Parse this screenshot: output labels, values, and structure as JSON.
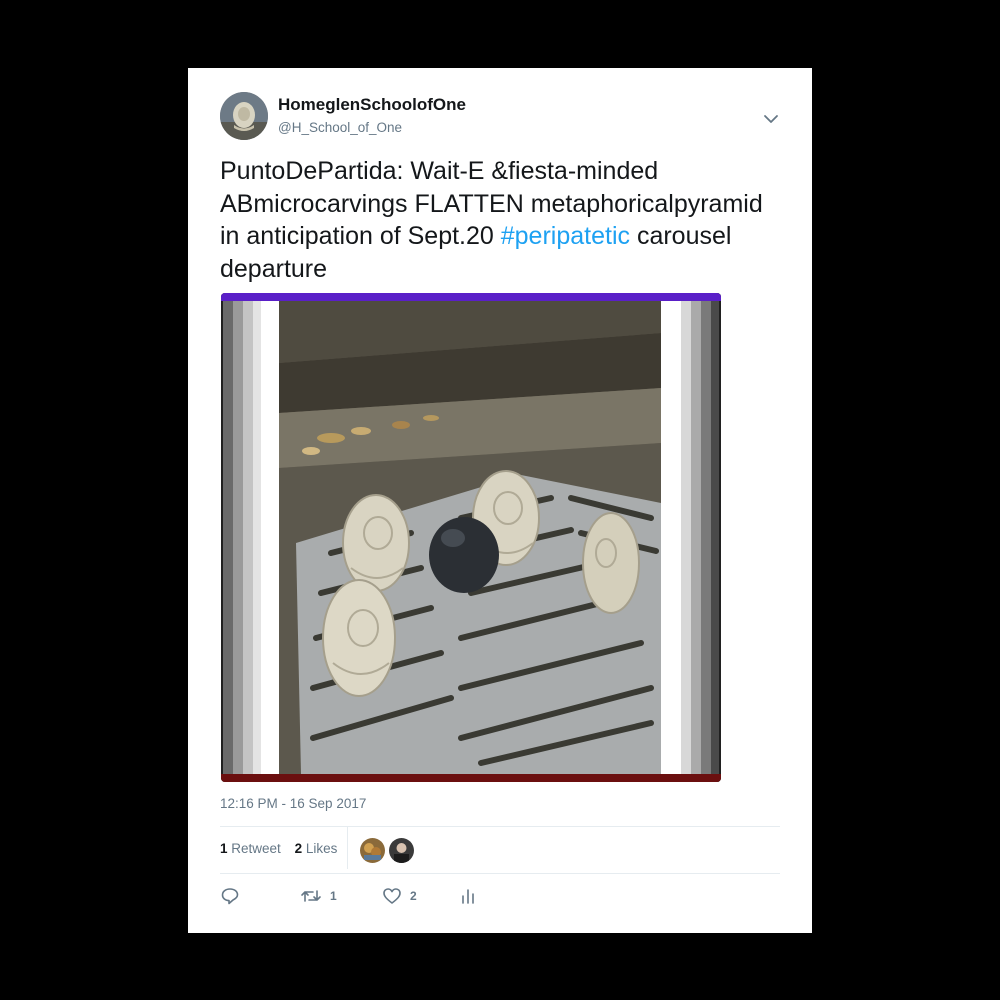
{
  "user": {
    "display_name": "HomeglenSchoolofOne",
    "handle": "@H_School_of_One"
  },
  "tweet": {
    "text_before": "PuntoDePartida: Wait-E &fiesta-minded ABmicrocarvings FLATTEN metaphoricalpyramid in anticipation of Sept.20 ",
    "hashtag": "#peripatetic",
    "text_after": " carousel departure",
    "timestamp": "12:16 PM - 16 Sep 2017"
  },
  "stats": {
    "retweets_count": "1",
    "retweets_label": "Retweet",
    "likes_count": "2",
    "likes_label": "Likes"
  },
  "actions": {
    "reply_count": "",
    "retweet_count": "1",
    "like_count": "2"
  },
  "colors": {
    "hashtag": "#1da1f2",
    "secondary_text": "#657786",
    "border_top": "#5a1fc8",
    "border_bottom": "#6b0f0f"
  },
  "icons": [
    "avatar",
    "chevron-down-icon",
    "reply-icon",
    "retweet-icon",
    "heart-icon",
    "analytics-icon"
  ]
}
